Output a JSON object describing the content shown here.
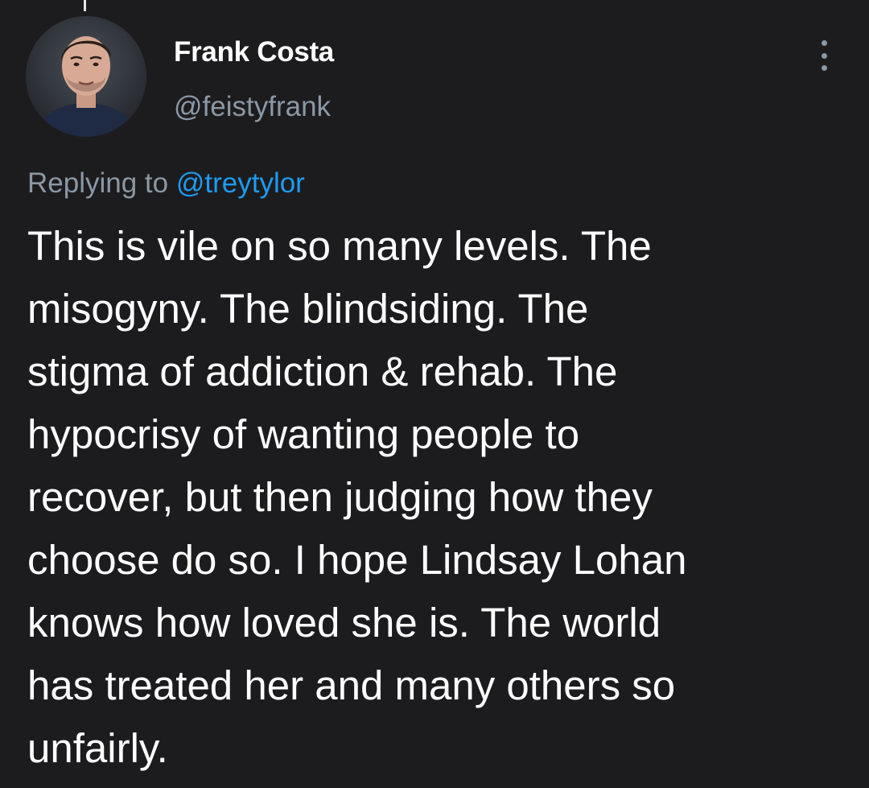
{
  "author": {
    "display_name": "Frank Costa",
    "handle": "@feistyfrank",
    "avatar_icon": "profile-photo"
  },
  "reply_context": {
    "prefix": "Replying to",
    "mention": "@treytylor"
  },
  "tweet": {
    "lines": [
      "This is vile on so many levels. The",
      "misogyny. The blindsiding. The",
      "stigma of addiction & rehab. The",
      "hypocrisy of wanting people to",
      "recover, but then judging how they",
      "choose do so. I hope Lindsay Lohan",
      "knows how loved she is. The world",
      "has treated her and many others so",
      "unfairly."
    ]
  },
  "menu": {
    "icon": "more-vertical-icon"
  },
  "colors": {
    "background": "#1c1c1e",
    "text": "#ffffff",
    "secondary_text": "#8b98a5",
    "link": "#1d9bf0"
  }
}
